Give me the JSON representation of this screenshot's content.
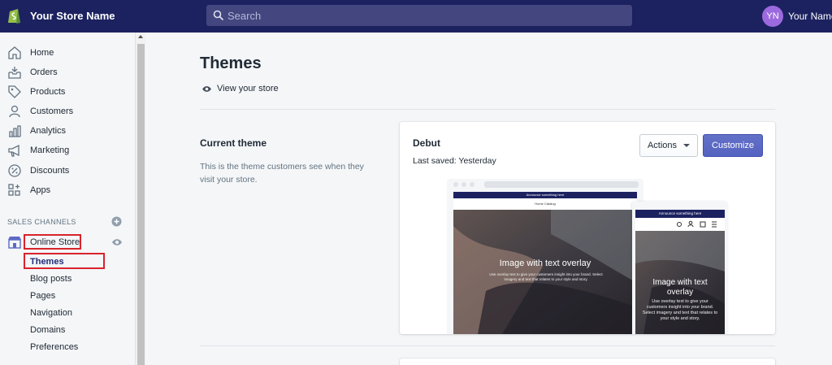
{
  "topbar": {
    "store_name": "Your Store Name",
    "search_placeholder": "Search",
    "avatar_initials": "YN",
    "user_name": "Your Name"
  },
  "sidebar": {
    "items": [
      {
        "label": "Home",
        "icon": "home-icon"
      },
      {
        "label": "Orders",
        "icon": "orders-icon"
      },
      {
        "label": "Products",
        "icon": "tag-icon"
      },
      {
        "label": "Customers",
        "icon": "person-icon"
      },
      {
        "label": "Analytics",
        "icon": "bar-chart-icon"
      },
      {
        "label": "Marketing",
        "icon": "megaphone-icon"
      },
      {
        "label": "Discounts",
        "icon": "discount-icon"
      },
      {
        "label": "Apps",
        "icon": "apps-icon"
      }
    ],
    "sales_channels_heading": "SALES CHANNELS",
    "online_store_label": "Online Store",
    "sub_items": [
      "Themes",
      "Blog posts",
      "Pages",
      "Navigation",
      "Domains",
      "Preferences"
    ]
  },
  "main": {
    "title": "Themes",
    "view_store_label": "View your store",
    "current_theme": {
      "heading": "Current theme",
      "description": "This is the theme customers see when they visit your store."
    },
    "theme_card": {
      "name": "Debut",
      "last_saved": "Last saved: Yesterday",
      "actions_label": "Actions",
      "customize_label": "Customize",
      "preview": {
        "desktop_announcement": "Announce something here",
        "desktop_nav": "Home   Catalog",
        "hero_title": "Image with text overlay",
        "hero_text": "Use overlay text to give your customers insight into your brand. Select imagery and text that relates to your style and story.",
        "mobile_announcement": "Announce something here",
        "mobile_hero_title": "Image with text overlay",
        "mobile_hero_text": "Use overlay text to give your customers insight into your brand. Select imagery and text that relates to your style and story."
      }
    }
  },
  "colors": {
    "topbar": "#1c2260",
    "primary_button": "#5c6ac4",
    "highlight_box": "#d9232b",
    "avatar": "#9c6ade"
  }
}
